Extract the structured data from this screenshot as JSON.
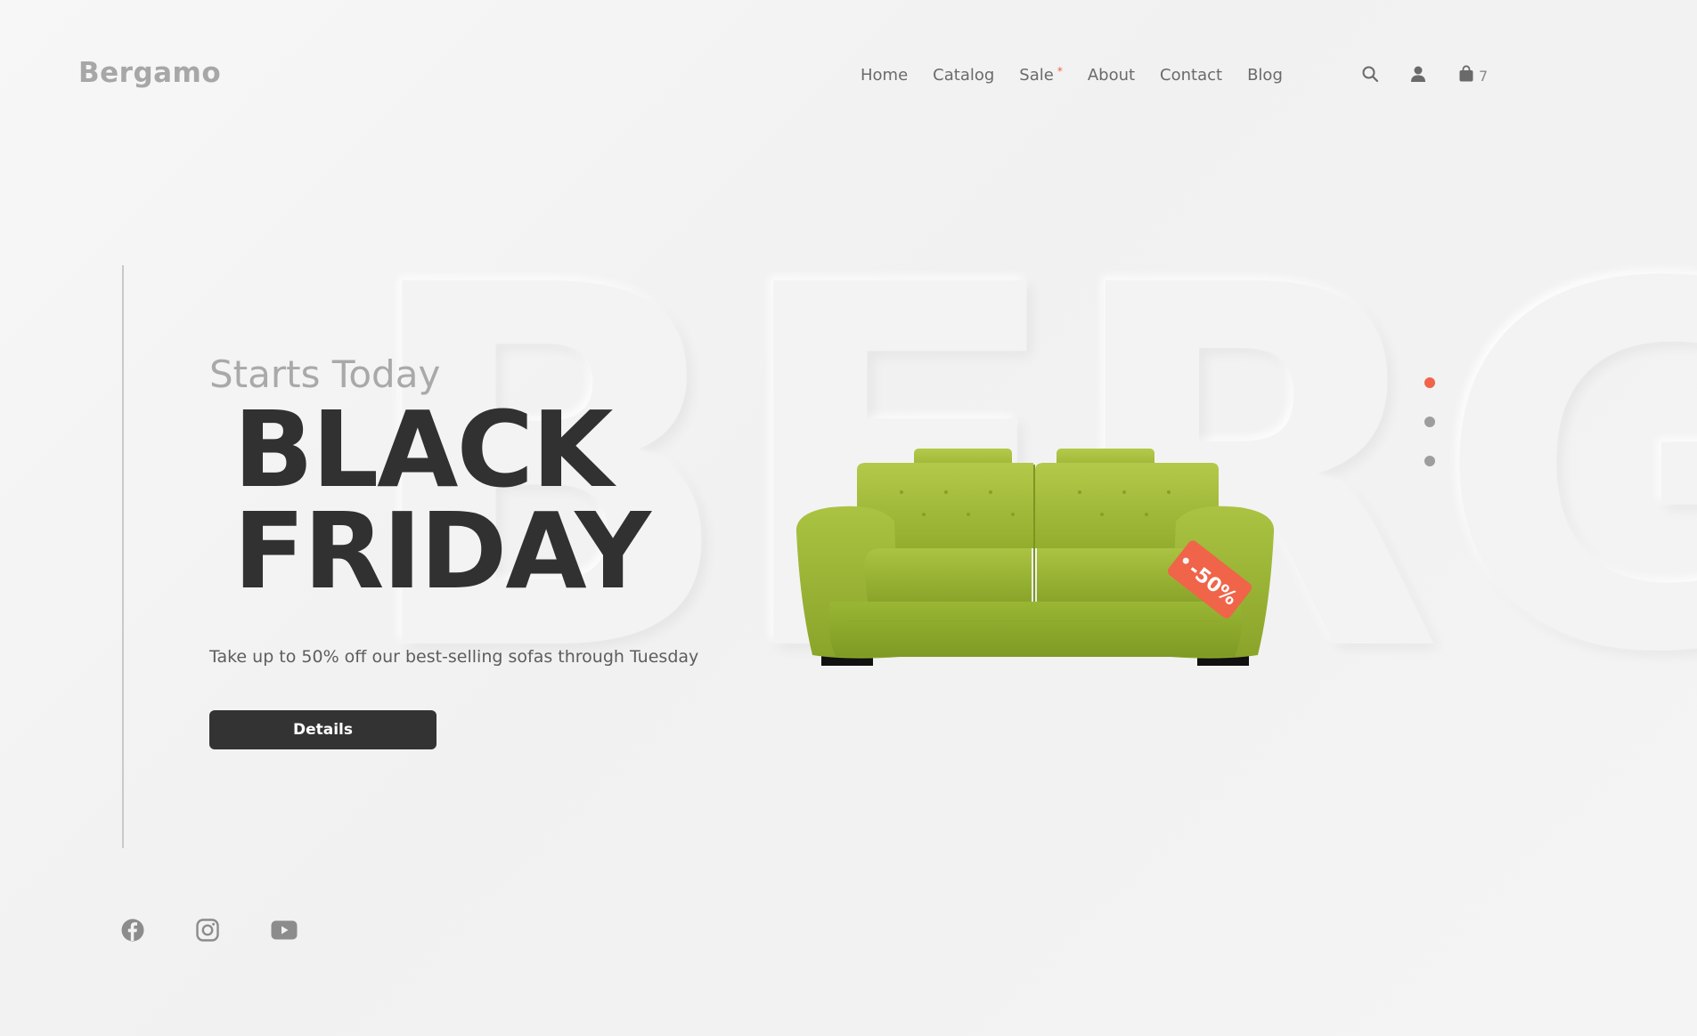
{
  "brand": {
    "logo": "Bergamo"
  },
  "nav": {
    "items": [
      {
        "label": "Home"
      },
      {
        "label": "Catalog"
      },
      {
        "label": "Sale",
        "marker": "*"
      },
      {
        "label": "About"
      },
      {
        "label": "Contact"
      },
      {
        "label": "Blog"
      }
    ]
  },
  "header_icons": {
    "search": "search-icon",
    "account": "user-icon",
    "cart": "shopping-bag-icon",
    "cart_count": "7"
  },
  "hero": {
    "watermark": "BERG",
    "subtitle": "Starts Today",
    "headline_line1": "BLACK",
    "headline_line2": "FRIDAY",
    "tagline": "Take up to 50% off our best-selling sofas through Tuesday",
    "button_label": "Details",
    "discount_tag": "-50%",
    "product_image": "green-leather-sofa"
  },
  "slider": {
    "total": 3,
    "active_index": 0
  },
  "social": [
    "facebook-icon",
    "instagram-icon",
    "youtube-icon"
  ],
  "colors": {
    "accent": "#f06449",
    "dark": "#333333",
    "muted": "#a9a9a9",
    "background": "#f3f3f3",
    "sofa_green": "#9bb53a"
  }
}
